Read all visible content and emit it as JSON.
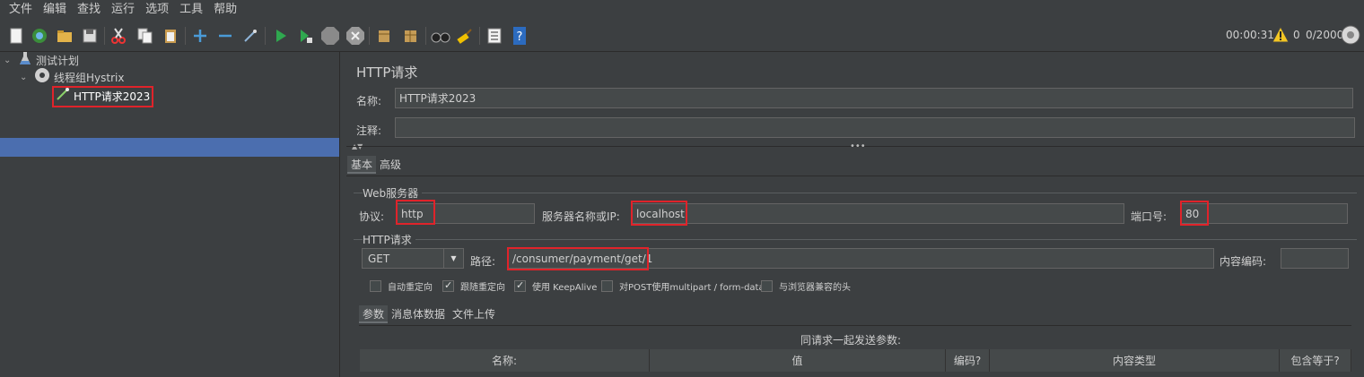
{
  "menu": [
    "文件",
    "编辑",
    "查找",
    "运行",
    "选项",
    "工具",
    "帮助"
  ],
  "toolbar": {
    "icons": [
      "new-icon",
      "templates-icon",
      "open-icon",
      "save-icon",
      "cut-icon",
      "copy-icon",
      "paste-icon",
      "add-icon",
      "remove-icon",
      "toggle-icon",
      "start-icon",
      "start-no-pause-icon",
      "stop-icon",
      "shutdown-icon",
      "clear-icon",
      "clear-all-icon",
      "search-icon",
      "reset-search-icon",
      "function-helper-icon",
      "help-icon"
    ],
    "timer": "00:00:31",
    "error_count": "0",
    "threads": "0/2000"
  },
  "tree": {
    "items": [
      {
        "label": "测试计划"
      },
      {
        "label": "线程组Hystrix"
      },
      {
        "label": "HTTP请求2023"
      }
    ]
  },
  "panel": {
    "title": "HTTP请求",
    "name_label": "名称:",
    "name_value": "HTTP请求2023",
    "comment_label": "注释:",
    "comment_value": "",
    "tabs": [
      "基本",
      "高级"
    ],
    "web_server": {
      "group_label": "Web服务器",
      "protocol_label": "协议:",
      "protocol_value": "http",
      "server_label": "服务器名称或IP:",
      "server_value": "localhost",
      "port_label": "端口号:",
      "port_value": "80"
    },
    "http_request": {
      "group_label": "HTTP请求",
      "method": "GET",
      "path_label": "路径:",
      "path_value": "/consumer/payment/get/1",
      "encoding_label": "内容编码:",
      "encoding_value": ""
    },
    "options": [
      {
        "label": "自动重定向",
        "checked": false
      },
      {
        "label": "跟随重定向",
        "checked": true
      },
      {
        "label": "使用 KeepAlive",
        "checked": true
      },
      {
        "label": "对POST使用multipart / form-data",
        "checked": false
      },
      {
        "label": "与浏览器兼容的头",
        "checked": false
      }
    ],
    "sub_tabs": [
      "参数",
      "消息体数据",
      "文件上传"
    ],
    "params_caption": "同请求一起发送参数:",
    "table_headers": [
      "名称:",
      "值",
      "编码?",
      "内容类型",
      "包含等于?"
    ]
  }
}
